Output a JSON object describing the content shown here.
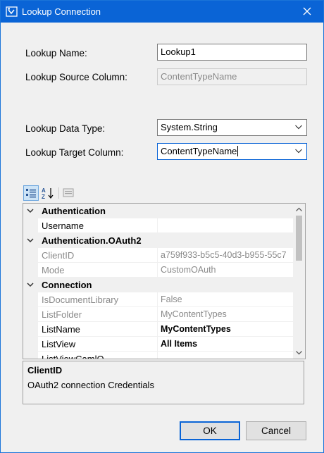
{
  "window": {
    "title": "Lookup Connection"
  },
  "icons": {
    "app": "ssis-lookup-icon",
    "close": "close-icon"
  },
  "form": {
    "lookup_name_label": "Lookup Name:",
    "lookup_name_value": "Lookup1",
    "lookup_source_label": "Lookup Source Column:",
    "lookup_source_value": "ContentTypeName",
    "data_type_label": "Lookup Data Type:",
    "data_type_value": "System.String",
    "target_column_label": "Lookup Target Column:",
    "target_column_value": "ContentTypeName"
  },
  "property_grid": {
    "toolbar": [
      "categorized-icon",
      "alphabetical-icon",
      "property-pages-icon"
    ],
    "rows": [
      {
        "kind": "category",
        "label": "Authentication"
      },
      {
        "kind": "prop",
        "name": "Username",
        "value": "",
        "readonly": false,
        "bold": false
      },
      {
        "kind": "category",
        "label": "Authentication.OAuth2"
      },
      {
        "kind": "prop",
        "name": "ClientID",
        "value": "a759f933-b5c5-40d3-b955-55c7",
        "readonly": true,
        "bold": false
      },
      {
        "kind": "prop",
        "name": "Mode",
        "value": "CustomOAuth",
        "readonly": true,
        "bold": false
      },
      {
        "kind": "category",
        "label": "Connection"
      },
      {
        "kind": "prop",
        "name": "IsDocumentLibrary",
        "value": "False",
        "readonly": true,
        "bold": false
      },
      {
        "kind": "prop",
        "name": "ListFolder",
        "value": "MyContentTypes",
        "readonly": true,
        "bold": false
      },
      {
        "kind": "prop",
        "name": "ListName",
        "value": "MyContentTypes",
        "readonly": false,
        "bold": true
      },
      {
        "kind": "prop",
        "name": "ListView",
        "value": "All Items",
        "readonly": false,
        "bold": true
      },
      {
        "kind": "prop",
        "name": "ListViewCamlQ",
        "value": "",
        "readonly": false,
        "bold": false
      }
    ]
  },
  "description": {
    "title": "ClientID",
    "text": "OAuth2 connection Credentials"
  },
  "buttons": {
    "ok": "OK",
    "cancel": "Cancel"
  },
  "colors": {
    "title_bar": "#0a64d6",
    "focus_border": "#0a64d6"
  }
}
